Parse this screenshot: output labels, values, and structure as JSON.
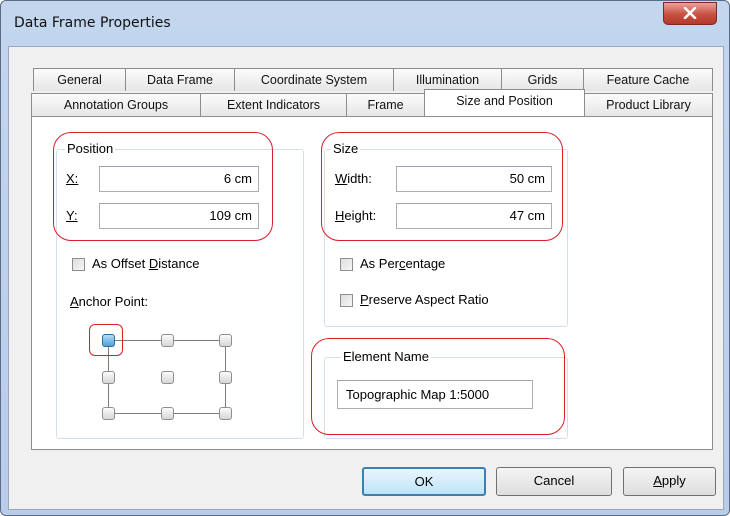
{
  "window": {
    "title": "Data Frame Properties"
  },
  "tabs_row1": [
    "General",
    "Data Frame",
    "Coordinate System",
    "Illumination",
    "Grids",
    "Feature Cache"
  ],
  "tabs_row2": [
    "Annotation Groups",
    "Extent Indicators",
    "Frame",
    "Size and Position",
    "Product Library"
  ],
  "active_tab": "Size and Position",
  "position": {
    "group_label": "Position",
    "x_label": "X:",
    "x_value": "6 cm",
    "y_label": "Y:",
    "y_value": "109 cm",
    "offset_label_pre": "As Offset ",
    "offset_label_ul": "D",
    "offset_label_post": "istance",
    "anchor_label_pre": "",
    "anchor_label_ul": "A",
    "anchor_label_post": "nchor Point:",
    "anchor_selected": "top-left"
  },
  "size": {
    "group_label": "Size",
    "width_label_ul": "W",
    "width_label_post": "idth:",
    "width_value": "50 cm",
    "height_label_ul": "H",
    "height_label_post": "eight:",
    "height_value": "47 cm",
    "percentage_pre": "As Per",
    "percentage_ul": "c",
    "percentage_post": "entage",
    "aspect_pre": "",
    "aspect_ul": "P",
    "aspect_post": "reserve Aspect Ratio"
  },
  "element_name": {
    "group_label": "Element Name",
    "value": "Topographic Map 1:5000"
  },
  "buttons": {
    "ok": "OK",
    "cancel": "Cancel",
    "apply_ul": "A",
    "apply_post": "pply"
  },
  "colors": {
    "highlight": "#d81f2a",
    "selected_anchor": "#4f9fd8",
    "title_bar": "#c3d6ee"
  }
}
